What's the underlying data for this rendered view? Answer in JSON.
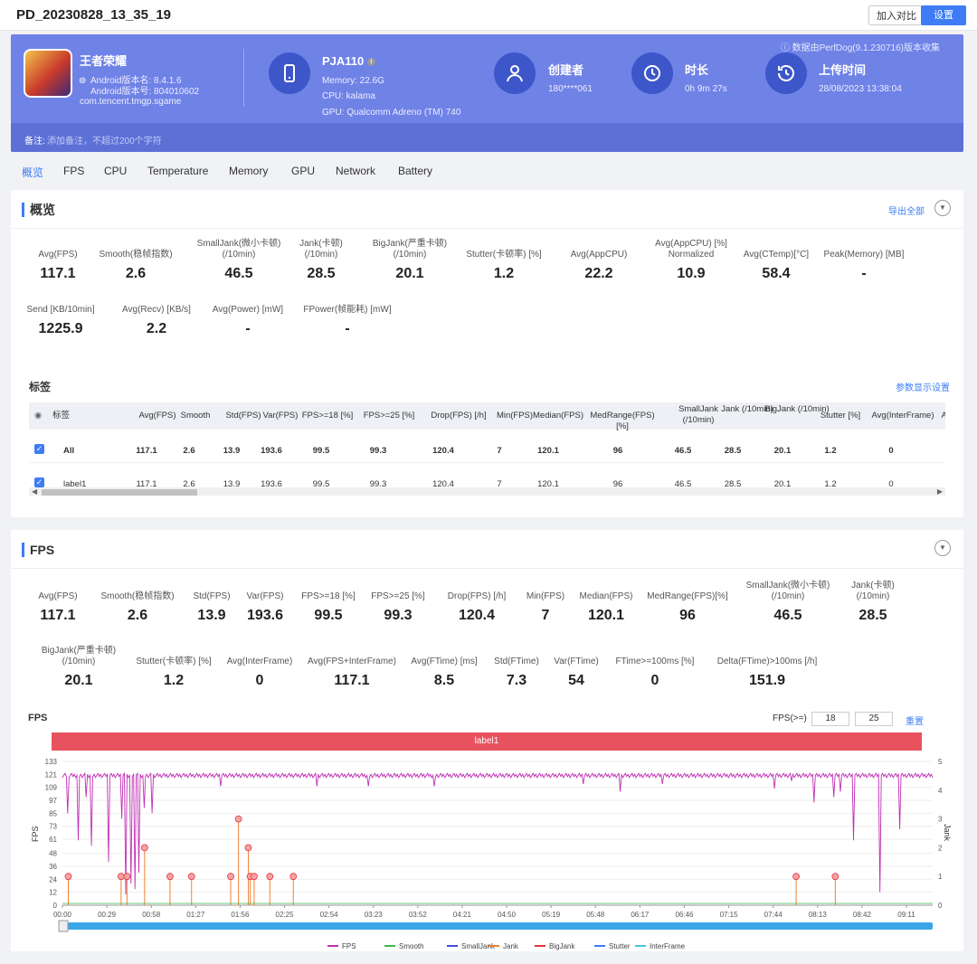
{
  "topbar": {
    "title": "PD_20230828_13_35_19",
    "compare": "加入对比",
    "settings": "设置"
  },
  "banner": {
    "collect_note": "数据由PerfDog(9.1.230716)版本收集",
    "app_name": "王者荣耀",
    "android_version_name": "Android版本名: 8.4.1.6",
    "android_version_code": "Android版本号: 804010602",
    "package": "com.tencent.tmgp.sgame",
    "device": "PJA110",
    "memory": "Memory: 22.6G",
    "cpu": "CPU: kalama",
    "gpu": "GPU: Qualcomm Adreno (TM) 740",
    "creator_label": "创建者",
    "creator": "180****061",
    "duration_label": "时长",
    "duration": "0h 9m 27s",
    "upload_label": "上传时间",
    "upload": "28/08/2023 13:38:04",
    "remark_label": "备注:",
    "remark_placeholder": "添加备注，不超过200个字符"
  },
  "tabs": [
    "概览",
    "FPS",
    "CPU",
    "Temperature",
    "Memory",
    "GPU",
    "Network",
    "Battery"
  ],
  "overview": {
    "title": "概览",
    "export": "导出全部",
    "metrics_row1": [
      {
        "label": "Avg(FPS)",
        "value": "117.1"
      },
      {
        "label": "Smooth(稳帧指数)",
        "value": "2.6"
      },
      {
        "label": "SmallJank(微小卡顿)",
        "label2": "(/10min)",
        "value": "46.5"
      },
      {
        "label": "Jank(卡顿)",
        "label2": "(/10min)",
        "value": "28.5"
      },
      {
        "label": "BigJank(严重卡顿)",
        "label2": "(/10min)",
        "value": "20.1"
      },
      {
        "label": "Stutter(卡顿率) [%]",
        "value": "1.2"
      },
      {
        "label": "Avg(AppCPU)",
        "value": "22.2"
      },
      {
        "label": "Avg(AppCPU) [%]",
        "label2": "Normalized",
        "value": "10.9"
      },
      {
        "label": "Avg(CTemp)[°C]",
        "value": "58.4"
      },
      {
        "label": "Peak(Memory) [MB]",
        "value": "-"
      }
    ],
    "metrics_row2": [
      {
        "label": "Send [KB/10min]",
        "value": "1225.9"
      },
      {
        "label": "Avg(Recv) [KB/s]",
        "value": "2.2"
      },
      {
        "label": "Avg(Power) [mW]",
        "value": "-"
      },
      {
        "label": "FPower(帧能耗) [mW]",
        "value": "-"
      }
    ],
    "tags_title": "标签",
    "param_settings": "参数显示设置",
    "table": {
      "headers": [
        "标签",
        "Avg(FPS)",
        "Smooth",
        "Std(FPS)",
        "Var(FPS)",
        "FPS>=18 [%]",
        "FPS>=25 [%]",
        "Drop(FPS) [/h]",
        "Min(FPS)",
        "Median(FPS)",
        "MedRange(FPS)[%]",
        "SmallJank (/10min)",
        "Jank (/10min)",
        "BigJank (/10min)",
        "Stutter [%]",
        "Avg(InterFrame)",
        "Avg(FF"
      ],
      "rows": [
        [
          "All",
          "117.1",
          "2.6",
          "13.9",
          "193.6",
          "99.5",
          "99.3",
          "120.4",
          "7",
          "120.1",
          "96",
          "46.5",
          "28.5",
          "20.1",
          "1.2",
          "0"
        ],
        [
          "label1",
          "117.1",
          "2.6",
          "13.9",
          "193.6",
          "99.5",
          "99.3",
          "120.4",
          "7",
          "120.1",
          "96",
          "46.5",
          "28.5",
          "20.1",
          "1.2",
          "0"
        ]
      ]
    }
  },
  "fps": {
    "title": "FPS",
    "metrics_row1": [
      {
        "label": "Avg(FPS)",
        "value": "117.1"
      },
      {
        "label": "Smooth(稳帧指数)",
        "value": "2.6"
      },
      {
        "label": "Std(FPS)",
        "value": "13.9"
      },
      {
        "label": "Var(FPS)",
        "value": "193.6"
      },
      {
        "label": "FPS>=18 [%]",
        "value": "99.5"
      },
      {
        "label": "FPS>=25 [%]",
        "value": "99.3"
      },
      {
        "label": "Drop(FPS) [/h]",
        "value": "120.4"
      },
      {
        "label": "Min(FPS)",
        "value": "7"
      },
      {
        "label": "Median(FPS)",
        "value": "120.1"
      },
      {
        "label": "MedRange(FPS)[%]",
        "value": "96"
      },
      {
        "label": "SmallJank(微小卡顿)",
        "label2": "(/10min)",
        "value": "46.5"
      },
      {
        "label": "Jank(卡顿)",
        "label2": "(/10min)",
        "value": "28.5"
      }
    ],
    "metrics_row2": [
      {
        "label": "BigJank(严重卡顿)",
        "label2": "(/10min)",
        "value": "20.1"
      },
      {
        "label": "Stutter(卡顿率) [%]",
        "value": "1.2"
      },
      {
        "label": "Avg(InterFrame)",
        "value": "0"
      },
      {
        "label": "Avg(FPS+InterFrame)",
        "value": "117.1"
      },
      {
        "label": "Avg(FTime) [ms]",
        "value": "8.5"
      },
      {
        "label": "Std(FTime)",
        "value": "7.3"
      },
      {
        "label": "Var(FTime)",
        "value": "54"
      },
      {
        "label": "FTime>=100ms [%]",
        "value": "0"
      },
      {
        "label": "Delta(FTime)>100ms [/h]",
        "value": "151.9"
      }
    ],
    "chart_title": "FPS",
    "fps_ge_label": "FPS(>=)",
    "fps_ge_1": "18",
    "fps_ge_2": "25",
    "reset": "重置"
  },
  "chart_data": {
    "type": "line",
    "label_band": "label1",
    "ylabel": "FPS",
    "y2label": "Jank",
    "y_ticks": [
      "133",
      "121",
      "109",
      "97",
      "85",
      "73",
      "61",
      "48",
      "36",
      "24",
      "12",
      "0"
    ],
    "y2_ticks": [
      "5",
      "4",
      "3",
      "2",
      "1",
      "0"
    ],
    "x_ticks": [
      "00:00",
      "00:29",
      "00:58",
      "01:27",
      "01:56",
      "02:25",
      "02:54",
      "03:23",
      "03:52",
      "04:21",
      "04:50",
      "05:19",
      "05:48",
      "06:17",
      "06:46",
      "07:15",
      "07:44",
      "08:13",
      "08:42",
      "09:11"
    ],
    "ylim": [
      0,
      133
    ],
    "y2lim": [
      0,
      5
    ],
    "series": [
      {
        "name": "FPS",
        "color": "#c02fb5",
        "baseline": 120
      },
      {
        "name": "Smooth",
        "color": "#3cb44b"
      },
      {
        "name": "SmallJank",
        "color": "#3f4fd8"
      },
      {
        "name": "Jank",
        "color": "#f08030"
      },
      {
        "name": "BigJank",
        "color": "#e8323c"
      },
      {
        "name": "Stutter",
        "color": "#3d7cf5"
      },
      {
        "name": "InterFrame",
        "color": "#3ec7e6"
      }
    ]
  }
}
